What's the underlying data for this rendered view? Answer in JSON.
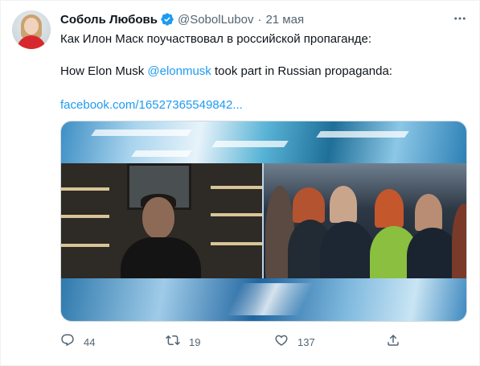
{
  "author": {
    "name": "Соболь Любовь",
    "handle": "@SobolLubov",
    "separator": "·",
    "date": "21 мая"
  },
  "tweet": {
    "text_ru": "Как Илон Маск поучаствовал в российской пропаганде:",
    "text_en_before": "How Elon Musk ",
    "mention": "@elonmusk",
    "text_en_after": " took part in Russian propaganda:",
    "link": "facebook.com/16527365549842..."
  },
  "stats": {
    "replies": "44",
    "retweets": "19",
    "likes": "137"
  },
  "icons": {
    "verified": "verified-badge-icon",
    "more": "more-options-icon",
    "reply": "reply-icon",
    "retweet": "retweet-icon",
    "like": "heart-icon",
    "share": "share-icon"
  },
  "colors": {
    "accent": "#1d9bf0",
    "secondary_text": "#536471",
    "primary_text": "#0f1419"
  }
}
